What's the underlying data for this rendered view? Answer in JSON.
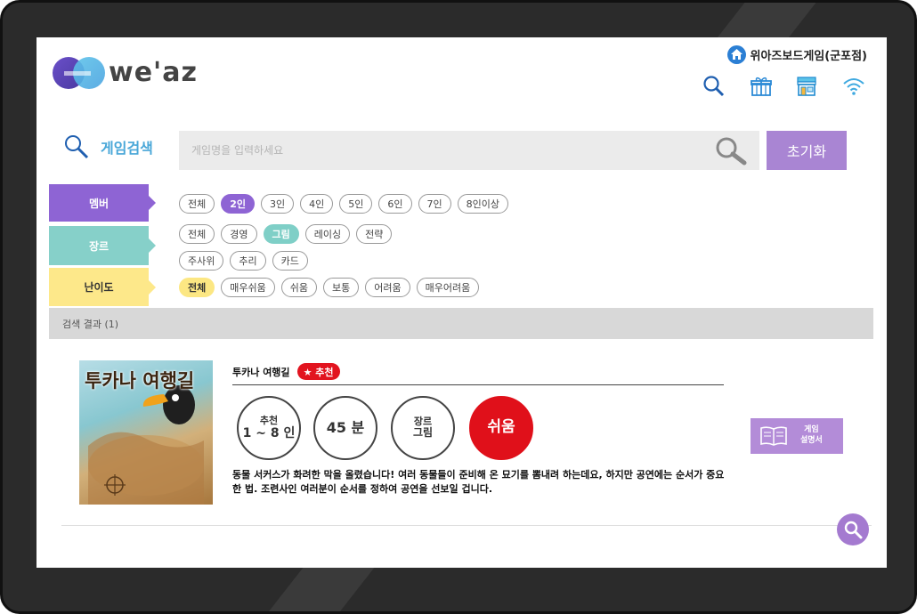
{
  "brand": {
    "logo_text": "we'az"
  },
  "store": {
    "name": "위아즈보드게임(군포점)"
  },
  "top_icons": [
    "search-icon",
    "gift-icon",
    "store-icon",
    "wifi-icon"
  ],
  "search": {
    "label": "게임검색",
    "placeholder": "게임명을 입력하세요",
    "reset_label": "초기화"
  },
  "filters": {
    "members": {
      "label": "멤버",
      "color": "#8e64d4",
      "options": [
        "전체",
        "2인",
        "3인",
        "4인",
        "5인",
        "6인",
        "7인",
        "8인이상"
      ],
      "selected": "2인"
    },
    "genre": {
      "label": "장르",
      "color": "#86d0c9",
      "options": [
        "전체",
        "경영",
        "그림",
        "레이싱",
        "전략",
        "주사위",
        "추리",
        "카드"
      ],
      "selected": "그림"
    },
    "difficulty": {
      "label": "난이도",
      "color": "#fde88a",
      "options": [
        "전체",
        "매우쉬움",
        "쉬움",
        "보통",
        "어려움",
        "매우어려움"
      ],
      "selected": "전체"
    }
  },
  "results": {
    "header": "검색 결과 (1)",
    "items": [
      {
        "title": "투카나 여행길",
        "badge": "★ 추천",
        "cover_title": "투카나 여행길",
        "players_top": "추천",
        "players": "1 ~ 8 인",
        "time": "45 분",
        "genre_top": "장르",
        "genre": "그림",
        "difficulty": "쉬움",
        "manual_line1": "게임",
        "manual_line2": "설명서",
        "description": "동물 서커스가 화려한 막을 올렸습니다! 여러 동물들이 준비해 온 묘기를 뽐내려 하는데요, 하지만 공연에는 순서가 중요한 법. 조련사인 여러분이 순서를 정하여 공연을 선보일 겁니다."
      }
    ]
  }
}
